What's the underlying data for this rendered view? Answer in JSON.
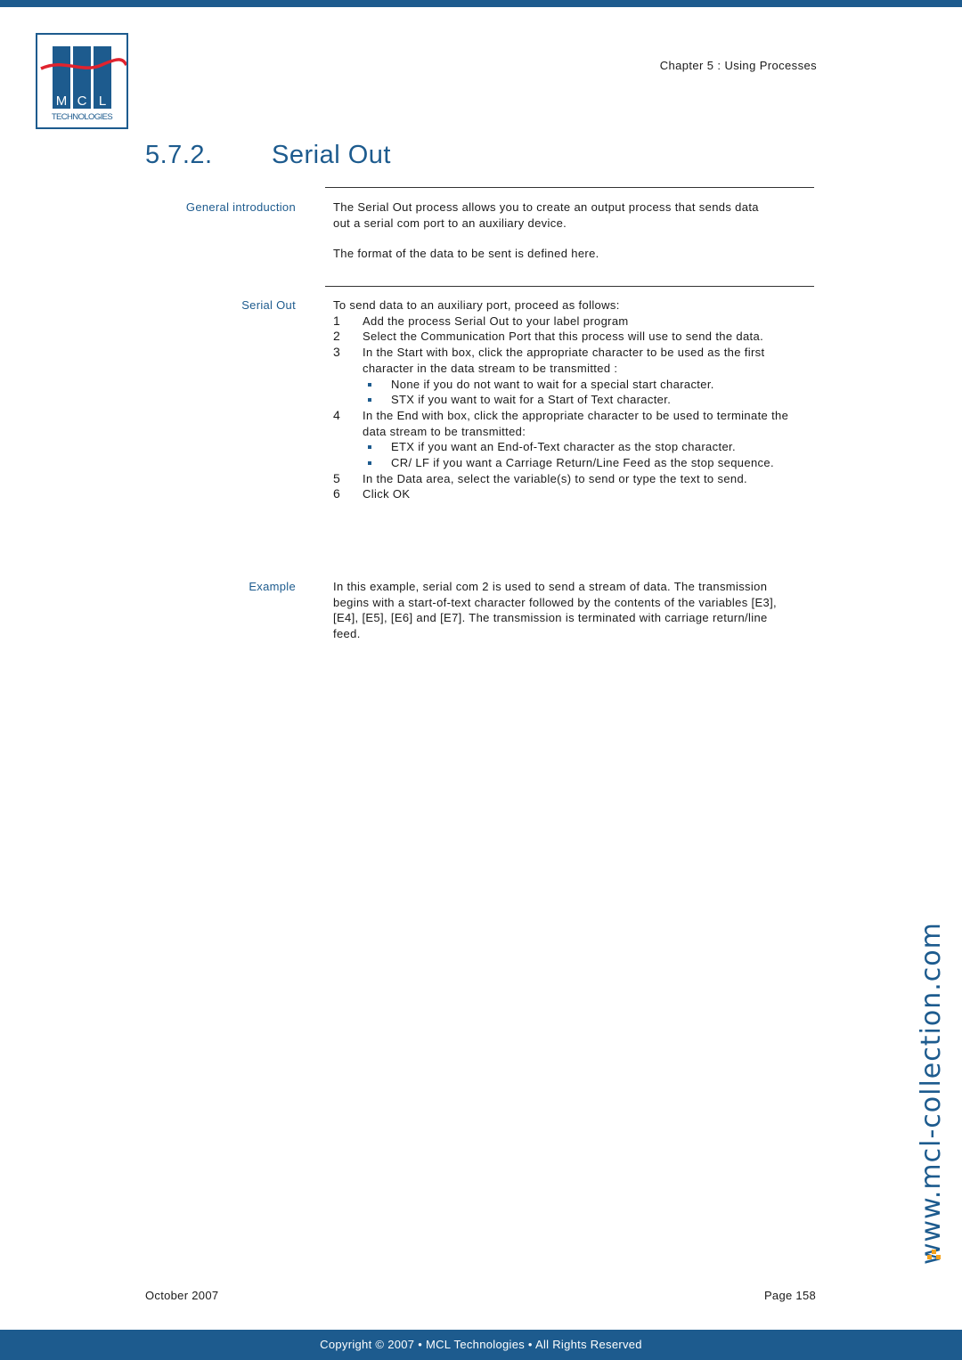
{
  "header": {
    "logo": {
      "letters": [
        "M",
        "C",
        "L"
      ],
      "subtitle": "TECHNOLOGIES"
    },
    "chapter": "Chapter 5 : Using Processes"
  },
  "section": {
    "number": "5.7.2.",
    "title": "Serial Out"
  },
  "blocks": {
    "intro": {
      "label": "General introduction",
      "paragraphs": [
        "The Serial Out process allows you to create an output process that sends data out a serial com port to an auxiliary device.",
        "The format of the data to be sent is defined here."
      ]
    },
    "serial_out": {
      "label": "Serial Out",
      "lead": "To send data to an auxiliary port, proceed as follows:",
      "steps": [
        {
          "num": "1",
          "text": "Add the process Serial Out to your label program"
        },
        {
          "num": "2",
          "text": "Select the Communication Port that this process will use to send the data."
        },
        {
          "num": "3",
          "text": "In the Start with box, click the appropriate character to be used as the first character in the data stream to be transmitted :",
          "bullets": [
            "None if you do not want to wait for a special start character.",
            "STX if you want to wait for a Start of Text character."
          ]
        },
        {
          "num": "4",
          "text": "In the End with box, click the appropriate character to be used to terminate the data stream to be transmitted:",
          "bullets": [
            "ETX if you want an End-of-Text character as the stop character.",
            "CR/ LF if you want a Carriage Return/Line Feed as the stop sequence."
          ]
        },
        {
          "num": "5",
          "text": "In the Data area, select the variable(s) to send or type the text to send."
        },
        {
          "num": "6",
          "text": "Click OK"
        }
      ]
    },
    "example": {
      "label": "Example",
      "text": "In this example, serial com 2 is used to send a stream of data. The transmission begins with a start-of-text character followed by the contents of the variables [E3], [E4], [E5], [E6] and [E7]. The transmission is terminated with carriage return/line feed."
    }
  },
  "watermark": "www.mcl-collection.com",
  "footer": {
    "date": "October 2007",
    "page": "Page 158",
    "copyright": "Copyright © 2007 • MCL Technologies • All Rights Reserved"
  },
  "colors": {
    "brand_blue": "#1d5b8e",
    "logo_red": "#e0232e",
    "accent_orange": "#f5a21c"
  }
}
